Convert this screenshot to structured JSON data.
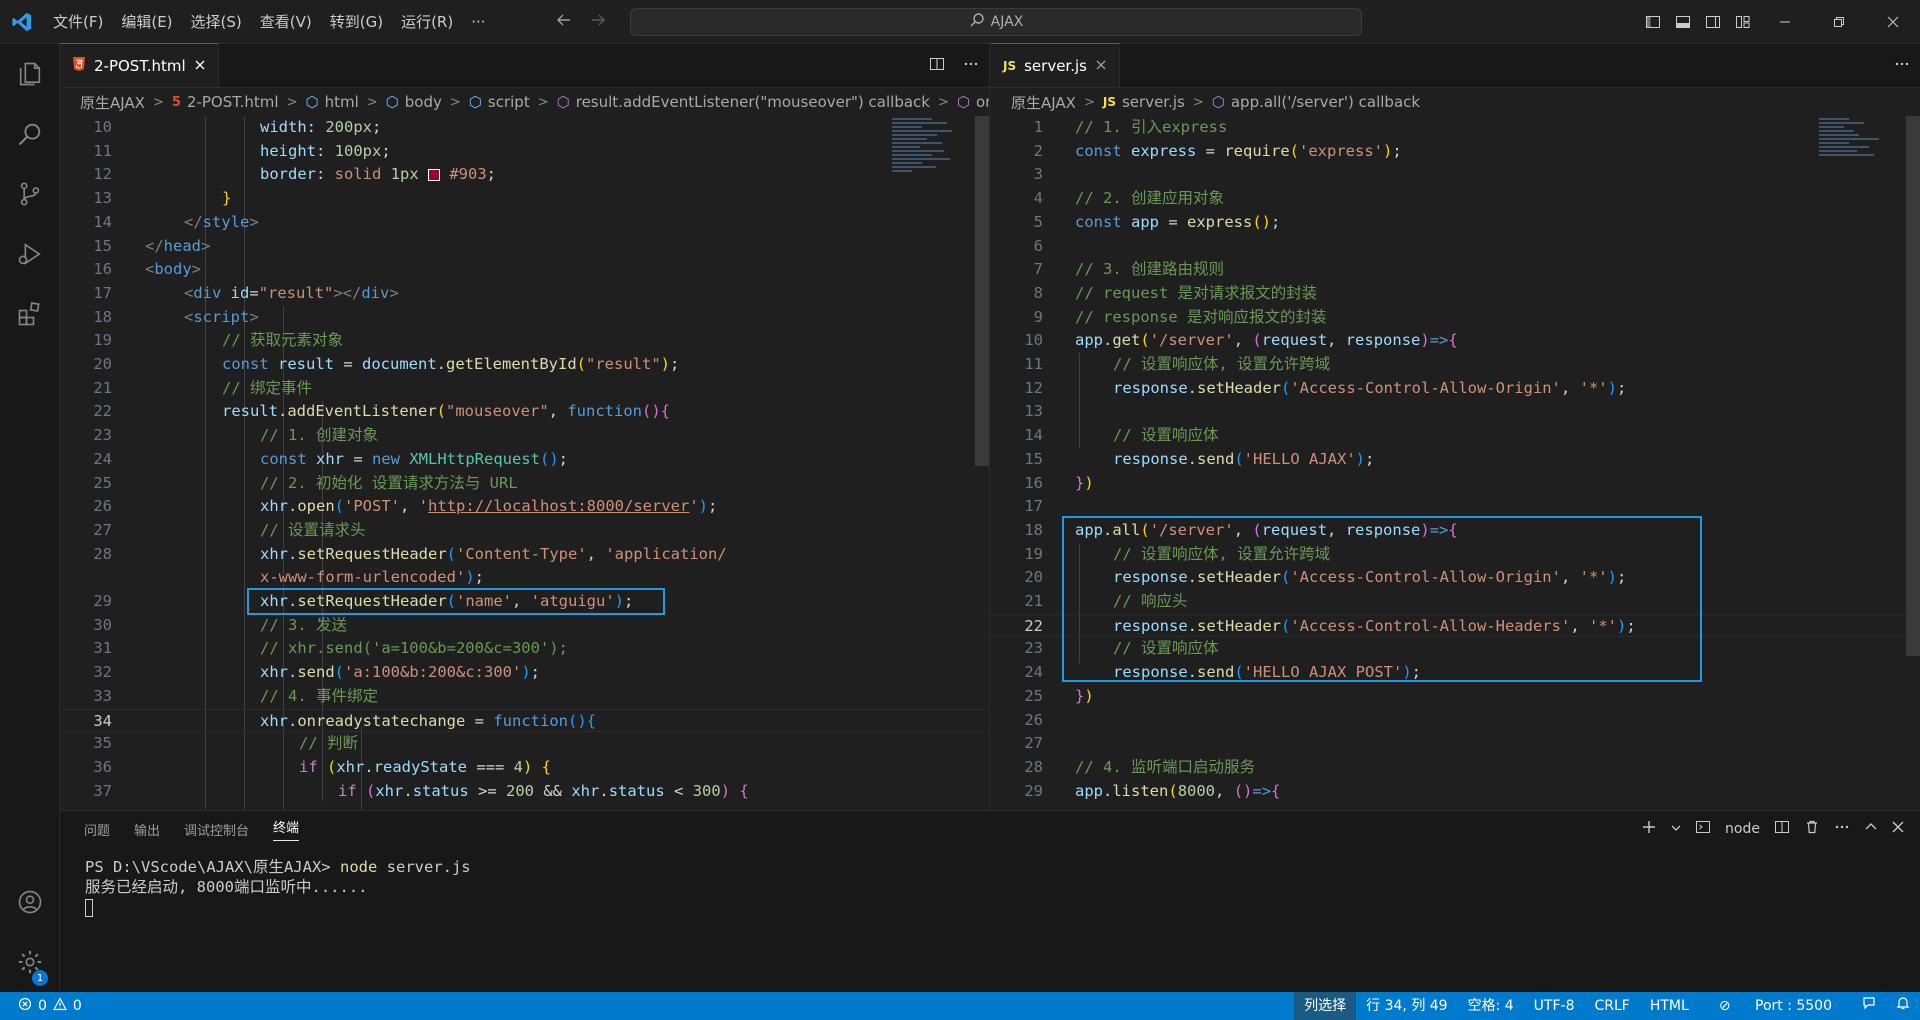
{
  "menu": [
    "文件(F)",
    "编辑(E)",
    "选择(S)",
    "查看(V)",
    "转到(G)",
    "运行(R)",
    "···"
  ],
  "search": {
    "label": "AJAX"
  },
  "editor_left": {
    "tab": "2-POST.html",
    "breadcrumb": [
      "原生AJAX",
      "2-POST.html",
      "html",
      "body",
      "script",
      "result.addEventListener(\"mouseover\") callback",
      "onreac"
    ],
    "line_numbers": [
      "10",
      "11",
      "12",
      "13",
      "14",
      "15",
      "16",
      "17",
      "18",
      "19",
      "20",
      "21",
      "22",
      "23",
      "24",
      "25",
      "26",
      "27",
      "28",
      "",
      "29",
      "30",
      "31",
      "32",
      "33",
      "34",
      "35",
      "36",
      "37"
    ]
  },
  "editor_right": {
    "tab": "server.js",
    "breadcrumb": [
      "原生AJAX",
      "server.js",
      "app.all('/server') callback"
    ],
    "line_numbers": [
      "1",
      "2",
      "3",
      "4",
      "5",
      "6",
      "7",
      "8",
      "9",
      "10",
      "11",
      "12",
      "13",
      "14",
      "15",
      "16",
      "17",
      "18",
      "19",
      "20",
      "21",
      "22",
      "23",
      "24",
      "25",
      "26",
      "27",
      "28",
      "29"
    ]
  },
  "panel": {
    "tabs": [
      "问题",
      "输出",
      "调试控制台",
      "终端"
    ],
    "shell": "node",
    "terminal": {
      "prompt": "PS D:\\VScode\\AJAX\\原生AJAX>",
      "command": "node",
      "arg": "server.js",
      "output": "服务已经启动, 8000端口监听中......"
    }
  },
  "status": {
    "errors": "0",
    "warnings": "0",
    "selection_mode": "列选择",
    "position": "行 34, 列 49",
    "indent": "空格: 4",
    "encoding": "UTF-8",
    "eol": "CRLF",
    "language": "HTML",
    "port": "Port : 5500"
  },
  "activity_badge": "1",
  "colors": {
    "accent": "#007acc",
    "highlight_box": "#1e9be0",
    "editor_bg": "#1f1f1f"
  },
  "icons": [
    "vscode-logo-icon",
    "files-icon",
    "search-icon",
    "source-control-icon",
    "run-debug-icon",
    "extensions-icon",
    "account-icon",
    "settings-gear-icon"
  ]
}
